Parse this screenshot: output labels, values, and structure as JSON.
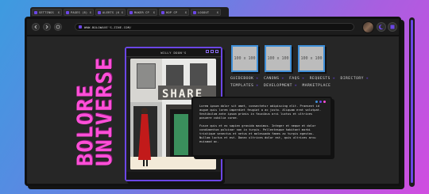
{
  "tabs": [
    {
      "label": "SETTINGS",
      "close": "x"
    },
    {
      "label": "PAGES (8)",
      "close": "x"
    },
    {
      "label": "ALERTS (6)",
      "close": "x"
    },
    {
      "label": "MAKER CP",
      "close": "x"
    },
    {
      "label": "HOP CP",
      "close": "x"
    },
    {
      "label": "LOGOUT",
      "close": "x"
    }
  ],
  "address": {
    "url": "WWW.BOLOWAVE'S-ZINE.COM/"
  },
  "vertical_text": {
    "line1": "BOLORE",
    "line2": "UNIVERSE"
  },
  "mini_window": {
    "title": "WILLY DOON'S",
    "sign": "SHARE"
  },
  "thumbs": [
    "100 x 100",
    "100 x 100",
    "100 x 100"
  ],
  "nav": {
    "row1": [
      "GUIDEBOOK",
      "CANONS",
      "FAQS",
      "REQUESTS",
      "DIRECTORY"
    ],
    "row2": [
      "TEMPLATES",
      "DEVELOPMENT",
      "MARKETPLACE"
    ],
    "sep": "✳"
  },
  "text_box": {
    "p1": "Lorem ipsum dolor sit amet, consectetur adipiscing elit. Praesent id augue quis lorem imperdiet feugiat a ac justo. Aliquam erat volutpat. Vestibulum ante ipsum primis in faucibus orci luctus et ultrices posuere cubilia curae.",
    "p2": "Fusce quis et ex sapien gravida maximus. Integer et neque et dolor condimentum pulvinar non in turpis. Pellentesque habitant morbi tristique senectus et netus et malesuada fames ac turpis egestas. Nullam luctus et est. Donec ultrices dolor est, quis ultrices arcu euismod ac."
  },
  "colors": {
    "accent": "#6b46e6",
    "pink": "#ff4fd8",
    "blue": "#3f8fd8",
    "window": "#262626"
  },
  "icons": [
    "back-arrow-icon",
    "forward-arrow-icon",
    "refresh-icon",
    "lock-icon",
    "moon-icon",
    "menu-icon"
  ]
}
